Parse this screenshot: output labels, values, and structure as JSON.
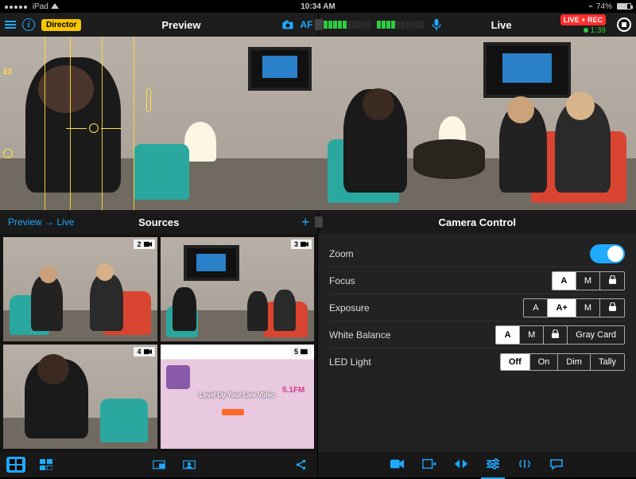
{
  "status": {
    "device": "iPad",
    "time": "10:34 AM",
    "battery": "74%",
    "carrier_wifi": true,
    "bluetooth": true
  },
  "topbar": {
    "director_chip": "Director",
    "preview_title": "Preview",
    "af_label": "AF",
    "live_title": "Live",
    "rec_chip": "LIVE + REC",
    "timer": "1:39"
  },
  "preview_scene": {
    "tag": "E2"
  },
  "subheader": {
    "preview_to_live": "Preview → Live",
    "sources": "Sources",
    "camera_control": "Camera Control"
  },
  "sources": [
    {
      "num": "2",
      "selected": "none"
    },
    {
      "num": "3",
      "selected": "red"
    },
    {
      "num": "4",
      "selected": "blue"
    },
    {
      "num": "5",
      "selected": "none",
      "overlay": "Level Up Your Live Video"
    }
  ],
  "camera": {
    "zoom": {
      "label": "Zoom",
      "on": true
    },
    "focus": {
      "label": "Focus",
      "opts": [
        "A",
        "M",
        "lock"
      ],
      "sel": "A"
    },
    "exposure": {
      "label": "Exposure",
      "opts": [
        "A",
        "A+",
        "M",
        "lock"
      ],
      "sel": "A+"
    },
    "wb": {
      "label": "White Balance",
      "opts": [
        "A",
        "M",
        "lock",
        "Gray Card"
      ],
      "sel": "A"
    },
    "led": {
      "label": "LED Light",
      "opts": [
        "Off",
        "On",
        "Dim",
        "Tally"
      ],
      "sel": "Off"
    }
  }
}
